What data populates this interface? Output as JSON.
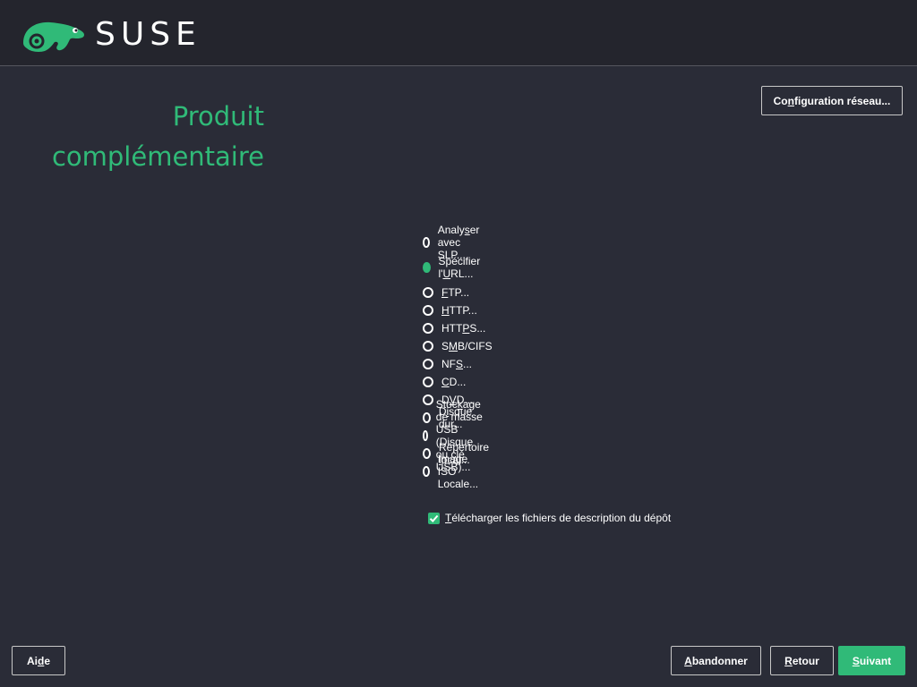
{
  "header": {
    "brand": "SUSE",
    "logo_icon": "chameleon-logo",
    "accent_color": "#30ba78"
  },
  "title": {
    "line1": "Produit",
    "line2": "complémentaire"
  },
  "network_button": {
    "pre": "Co",
    "key": "n",
    "post": "figuration réseau..."
  },
  "source_options": {
    "scan_slp": {
      "pre": "Analy",
      "key": "s",
      "post": "er avec SLP...",
      "selected": false
    },
    "specify_url": {
      "pre": "Spécifier l'",
      "key": "U",
      "post": "RL...",
      "selected": true
    },
    "items": [
      {
        "pre": "",
        "key": "F",
        "post": "TP..."
      },
      {
        "pre": "",
        "key": "H",
        "post": "TTP..."
      },
      {
        "pre": "HTT",
        "key": "P",
        "post": "S..."
      },
      {
        "pre": "S",
        "key": "M",
        "post": "B/CIFS"
      },
      {
        "pre": "NF",
        "key": "S",
        "post": "..."
      },
      {
        "pre": "",
        "key": "C",
        "post": "D..."
      },
      {
        "pre": "D",
        "key": "V",
        "post": "D..."
      },
      {
        "pre": "D",
        "key": "i",
        "post": "sque dur..."
      },
      {
        "pre": "Stoc",
        "key": "k",
        "post": "age de masse USB (Disque ou clé USB)..."
      },
      {
        "pre": "Répertoire ",
        "key": "l",
        "post": "ocal..."
      },
      {
        "pre": "Ima",
        "key": "g",
        "post": "e ISO Locale..."
      }
    ]
  },
  "download_checkbox": {
    "pre": "",
    "key": "T",
    "post": "élécharger les fichiers de description du dépôt",
    "checked": true
  },
  "footer": {
    "help": {
      "pre": "Ai",
      "key": "d",
      "post": "e"
    },
    "abort": {
      "pre": "",
      "key": "A",
      "post": "bandonner"
    },
    "back": {
      "pre": "",
      "key": "R",
      "post": "etour"
    },
    "next": {
      "pre": "",
      "key": "S",
      "post": "uivant"
    }
  }
}
